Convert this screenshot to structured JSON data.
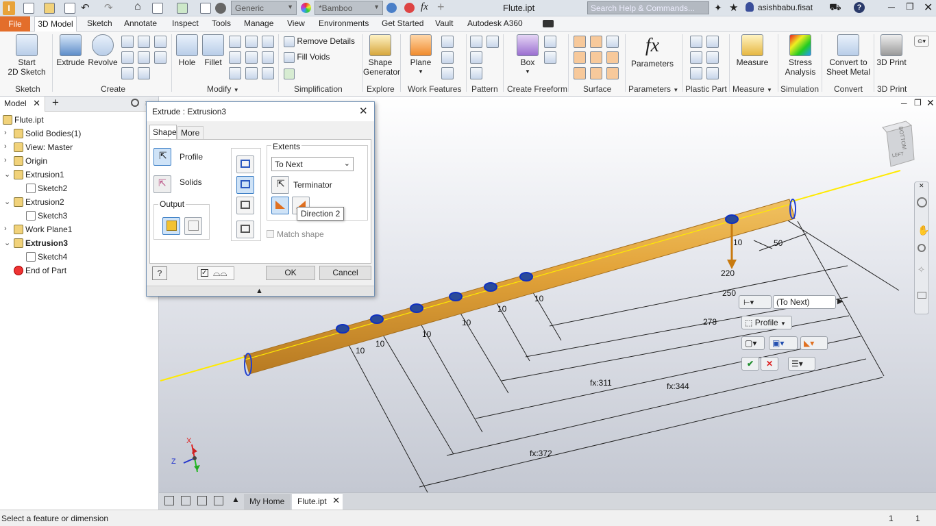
{
  "titlebar": {
    "app_menu": "I",
    "material": "Generic",
    "appearance": "*Bamboo",
    "filename": "Flute.ipt",
    "search_placeholder": "Search Help & Commands...",
    "user": "asishbabu.fisat"
  },
  "menu": {
    "file": "File",
    "tabs": [
      "3D Model",
      "Sketch",
      "Annotate",
      "Inspect",
      "Tools",
      "Manage",
      "View",
      "Environments",
      "Get Started",
      "Vault",
      "Autodesk A360"
    ]
  },
  "ribbon": {
    "start_sketch": "Start",
    "start_sketch2": "2D Sketch",
    "extrude": "Extrude",
    "revolve": "Revolve",
    "hole": "Hole",
    "fillet": "Fillet",
    "remove_details": "Remove Details",
    "fill_voids": "Fill Voids",
    "shape_generator": "Shape",
    "shape_generator2": "Generator",
    "plane": "Plane",
    "box": "Box",
    "parameters": "Parameters",
    "measure": "Measure",
    "stress": "Stress",
    "stress2": "Analysis",
    "convert": "Convert to",
    "convert2": "Sheet Metal",
    "print3d": "3D Print",
    "panels": {
      "sketch": "Sketch",
      "create": "Create",
      "modify": "Modify",
      "simplification": "Simplification",
      "explore": "Explore",
      "work_features": "Work Features",
      "pattern": "Pattern",
      "create_freeform": "Create Freeform",
      "surface": "Surface",
      "parameters": "Parameters",
      "plastic_part": "Plastic Part",
      "measure": "Measure",
      "simulation": "Simulation",
      "convert": "Convert",
      "print3d": "3D Print"
    }
  },
  "browser": {
    "tab": "Model",
    "items": [
      {
        "label": "Flute.ipt",
        "indent": 0,
        "bold": false,
        "twisty": ""
      },
      {
        "label": "Solid Bodies(1)",
        "indent": 1,
        "bold": false,
        "twisty": "›"
      },
      {
        "label": "View: Master",
        "indent": 1,
        "bold": false,
        "twisty": "›"
      },
      {
        "label": "Origin",
        "indent": 1,
        "bold": false,
        "twisty": "›"
      },
      {
        "label": "Extrusion1",
        "indent": 1,
        "bold": false,
        "twisty": "⌄"
      },
      {
        "label": "Sketch2",
        "indent": 2,
        "bold": false,
        "twisty": ""
      },
      {
        "label": "Extrusion2",
        "indent": 1,
        "bold": false,
        "twisty": "⌄"
      },
      {
        "label": "Sketch3",
        "indent": 2,
        "bold": false,
        "twisty": ""
      },
      {
        "label": "Work Plane1",
        "indent": 1,
        "bold": false,
        "twisty": "›"
      },
      {
        "label": "Extrusion3",
        "indent": 1,
        "bold": true,
        "twisty": "⌄"
      },
      {
        "label": "Sketch4",
        "indent": 2,
        "bold": false,
        "twisty": ""
      },
      {
        "label": "End of Part",
        "indent": 1,
        "bold": false,
        "twisty": ""
      }
    ]
  },
  "dialog": {
    "title": "Extrude : Extrusion3",
    "tab_shape": "Shape",
    "tab_more": "More",
    "profile": "Profile",
    "solids": "Solids",
    "output": "Output",
    "extents": "Extents",
    "extents_value": "To Next",
    "terminator": "Terminator",
    "tooltip": "Direction 2",
    "match_shape": "Match shape",
    "ok": "OK",
    "cancel": "Cancel"
  },
  "viewport": {
    "dims": {
      "d10a": "10",
      "d10b": "10",
      "d10c": "10",
      "d10d": "10",
      "d10e": "10",
      "d10f": "10",
      "d10g": "10",
      "d50": "50",
      "d220": "220",
      "d250": "250",
      "d278": "278",
      "f311": "fx:311",
      "f344": "fx:344",
      "f372": "fx:372"
    },
    "mini_value": "(To Next)",
    "mini_profile": "Profile",
    "viewcube": "BOTTOM",
    "viewcube2": "LEFT",
    "axis_x": "X",
    "axis_z": "Z"
  },
  "doctabs": {
    "home": "My Home",
    "file": "Flute.ipt"
  },
  "status": {
    "message": "Select a feature or dimension",
    "count1": "1",
    "count2": "1"
  }
}
